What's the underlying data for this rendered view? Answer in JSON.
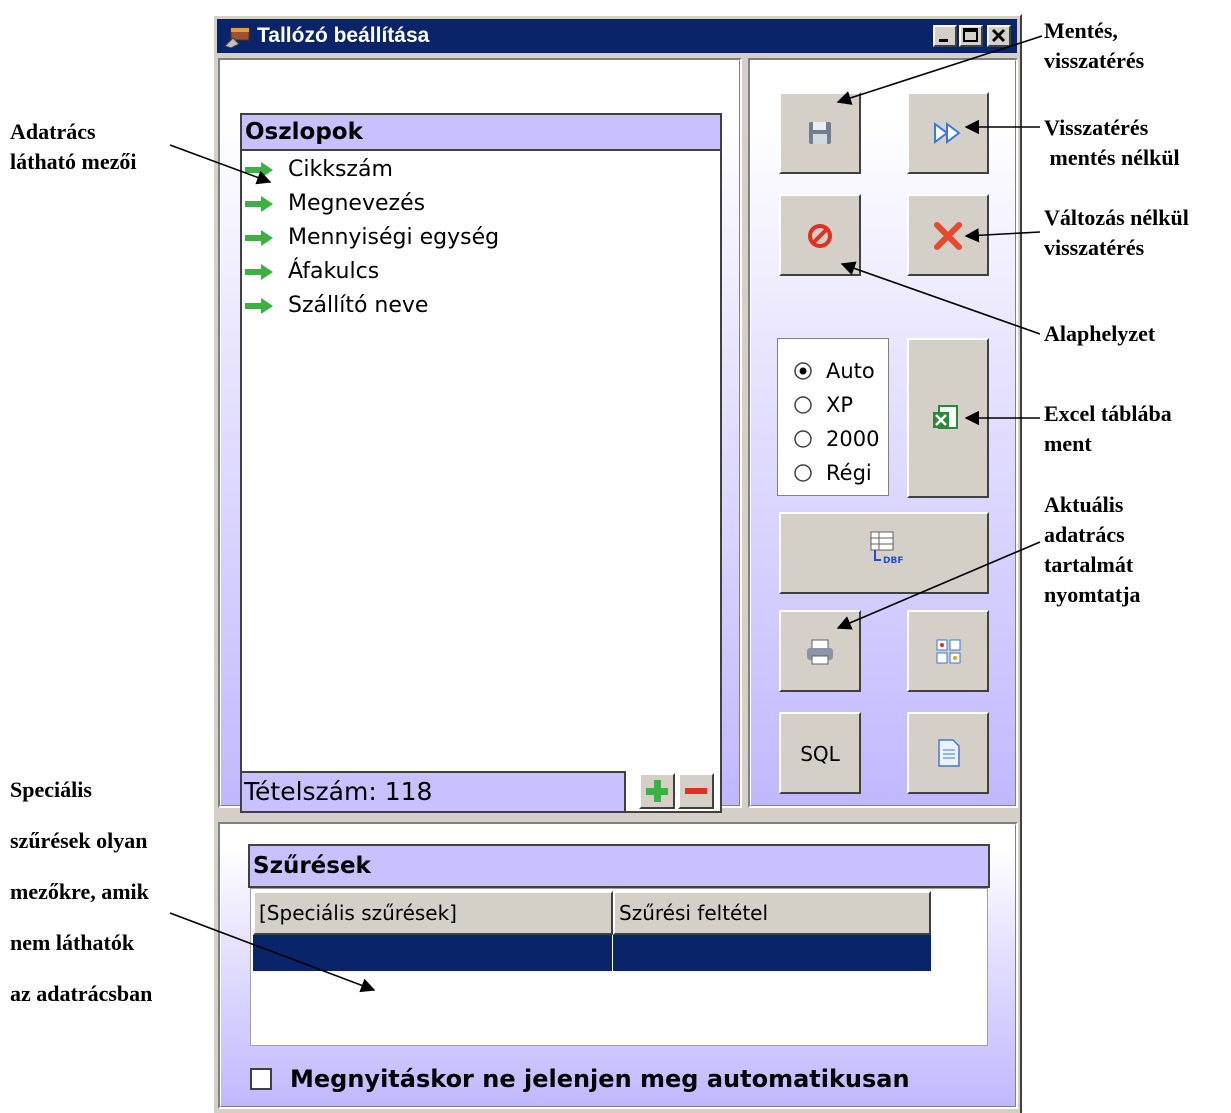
{
  "window": {
    "title": "Tallózó beállítása"
  },
  "columns_panel": {
    "header": "Oszlopok",
    "items": [
      {
        "label": "Cikkszám"
      },
      {
        "label": "Megnevezés"
      },
      {
        "label": "Mennyiségi egység"
      },
      {
        "label": "Áfakulcs"
      },
      {
        "label": "Szállító neve"
      }
    ],
    "item_count": "Tételszám: 118"
  },
  "buttons": {
    "sql_label": "SQL",
    "dbf_label": "DBF"
  },
  "style_radio": {
    "selected": "Auto",
    "options": [
      "Auto",
      "XP",
      "2000",
      "Régi"
    ]
  },
  "filters": {
    "header": "Szűrések",
    "columns": [
      "[Speciális szűrések]",
      "Szűrési feltétel"
    ],
    "autoshow_checkbox_label": "Megnyitáskor ne jelenjen meg automatikusan",
    "autoshow_checked": false
  },
  "annotations": {
    "save_return": [
      "Mentés,",
      "visszatérés"
    ],
    "return_without_save": [
      "Visszatérés",
      " mentés nélkül"
    ],
    "return_no_change": [
      "Változás nélkül",
      "visszatérés"
    ],
    "reset": [
      "Alaphelyzet"
    ],
    "excel_export": [
      "Excel táblába",
      "ment"
    ],
    "print_grid": [
      "Aktuális",
      "adatrács",
      "tartalmát",
      "nyomtatja"
    ],
    "visible_fields": [
      "Adatrács",
      "látható mezői"
    ],
    "special_filters": [
      "Speciális",
      "szűrések olyan",
      "mezőkre, amik",
      "nem láthatók",
      "az adatrácsban"
    ]
  },
  "colors": {
    "titlebar": "#0a246a",
    "panel_header": "#c8c0ff",
    "selection": "#0a246a",
    "arrow_green": "#3cb043"
  }
}
